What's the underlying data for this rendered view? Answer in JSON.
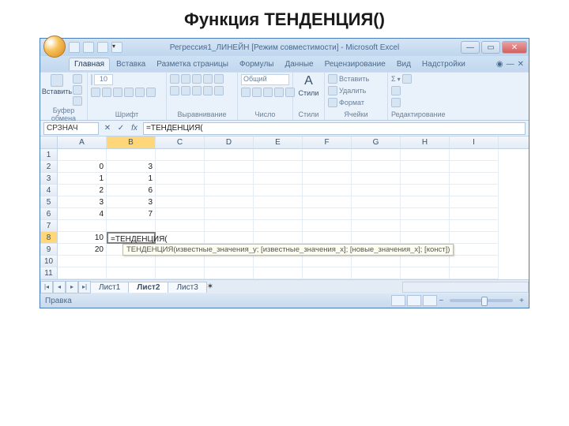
{
  "slide": {
    "title": "Функция ТЕНДЕНЦИЯ()"
  },
  "window": {
    "title": "Регрессия1_ЛИНЕЙН [Режим совместимости] - Microsoft Excel"
  },
  "tabs": {
    "items": [
      "Главная",
      "Вставка",
      "Разметка страницы",
      "Формулы",
      "Данные",
      "Рецензирование",
      "Вид",
      "Надстройки"
    ],
    "active": 0
  },
  "ribbon": {
    "clipboard": {
      "paste": "Вставить",
      "label": "Буфер обмена"
    },
    "font": {
      "size": "10",
      "label": "Шрифт"
    },
    "align": {
      "label": "Выравнивание"
    },
    "number": {
      "format": "Общий",
      "label": "Число"
    },
    "styles": {
      "a": "A",
      "label": "Стили"
    },
    "cells": {
      "insert": "Вставить",
      "delete": "Удалить",
      "format": "Формат",
      "label": "Ячейки"
    },
    "editing": {
      "label": "Редактирование"
    }
  },
  "namebox": "СРЗНАЧ",
  "fx": {
    "cancel": "✕",
    "accept": "✓",
    "fx": "fx"
  },
  "formula": "=ТЕНДЕНЦИЯ(",
  "columns": [
    "A",
    "B",
    "C",
    "D",
    "E",
    "F",
    "G",
    "H",
    "I"
  ],
  "rows": [
    {
      "n": "1",
      "cells": [
        "",
        "",
        "",
        "",
        "",
        "",
        "",
        "",
        ""
      ]
    },
    {
      "n": "2",
      "cells": [
        "0",
        "3",
        "",
        "",
        "",
        "",
        "",
        "",
        ""
      ]
    },
    {
      "n": "3",
      "cells": [
        "1",
        "1",
        "",
        "",
        "",
        "",
        "",
        "",
        ""
      ]
    },
    {
      "n": "4",
      "cells": [
        "2",
        "6",
        "",
        "",
        "",
        "",
        "",
        "",
        ""
      ]
    },
    {
      "n": "5",
      "cells": [
        "3",
        "3",
        "",
        "",
        "",
        "",
        "",
        "",
        ""
      ]
    },
    {
      "n": "6",
      "cells": [
        "4",
        "7",
        "",
        "",
        "",
        "",
        "",
        "",
        ""
      ]
    },
    {
      "n": "7",
      "cells": [
        "",
        "",
        "",
        "",
        "",
        "",
        "",
        "",
        ""
      ]
    },
    {
      "n": "8",
      "cells": [
        "10",
        "=ТЕНДЕНЦИЯ(",
        "",
        "",
        "",
        "",
        "",
        "",
        ""
      ]
    },
    {
      "n": "9",
      "cells": [
        "20",
        "",
        "",
        "",
        "",
        "",
        "",
        "",
        ""
      ]
    },
    {
      "n": "10",
      "cells": [
        "",
        "",
        "",
        "",
        "",
        "",
        "",
        "",
        ""
      ]
    },
    {
      "n": "11",
      "cells": [
        "",
        "",
        "",
        "",
        "",
        "",
        "",
        "",
        ""
      ]
    }
  ],
  "tooltip": "ТЕНДЕНЦИЯ(известные_значения_y; [известные_значения_x]; [новые_значения_x]; [конст])",
  "tooltip_row_index": 8,
  "sheets": {
    "items": [
      "Лист1",
      "Лист2",
      "Лист3"
    ],
    "active": 1
  },
  "status": {
    "mode": "Правка",
    "zoom_minus": "−",
    "zoom_plus": "+"
  }
}
